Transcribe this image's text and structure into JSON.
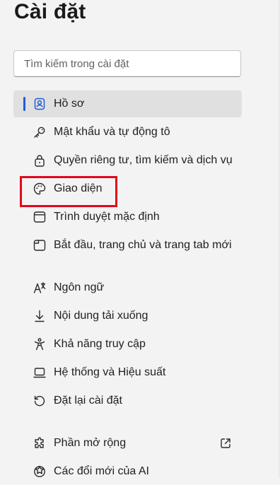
{
  "page": {
    "title": "Cài đặt"
  },
  "search": {
    "placeholder": "Tìm kiếm trong cài đặt"
  },
  "nav": {
    "items": [
      {
        "label": "Hồ sơ",
        "icon": "profile-icon",
        "selected": true
      },
      {
        "label": "Mật khẩu và tự động tô",
        "icon": "key-icon"
      },
      {
        "label": "Quyền riêng tư, tìm kiếm và dịch vụ",
        "icon": "lock-icon"
      },
      {
        "label": "Giao diện",
        "icon": "palette-icon",
        "highlighted": true
      },
      {
        "label": "Trình duyệt mặc định",
        "icon": "browser-window-icon"
      },
      {
        "label": "Bắt đầu, trang chủ và trang tab mới",
        "icon": "home-page-icon"
      },
      {
        "label": "Ngôn ngữ",
        "icon": "language-icon"
      },
      {
        "label": "Nội dung tải xuống",
        "icon": "download-icon"
      },
      {
        "label": "Khả năng truy cập",
        "icon": "accessibility-icon"
      },
      {
        "label": "Hệ thống và Hiệu suất",
        "icon": "laptop-icon"
      },
      {
        "label": "Đặt lại cài đặt",
        "icon": "reset-icon"
      },
      {
        "label": "Phần mở rộng",
        "icon": "puzzle-icon",
        "external": true
      },
      {
        "label": "Các đổi mới của AI",
        "icon": "ai-icon"
      }
    ]
  },
  "colors": {
    "background": "#f3f3f3",
    "selected_background": "#e0e0e0",
    "accent": "#1d5ed8",
    "highlight_border": "#e0081e"
  }
}
